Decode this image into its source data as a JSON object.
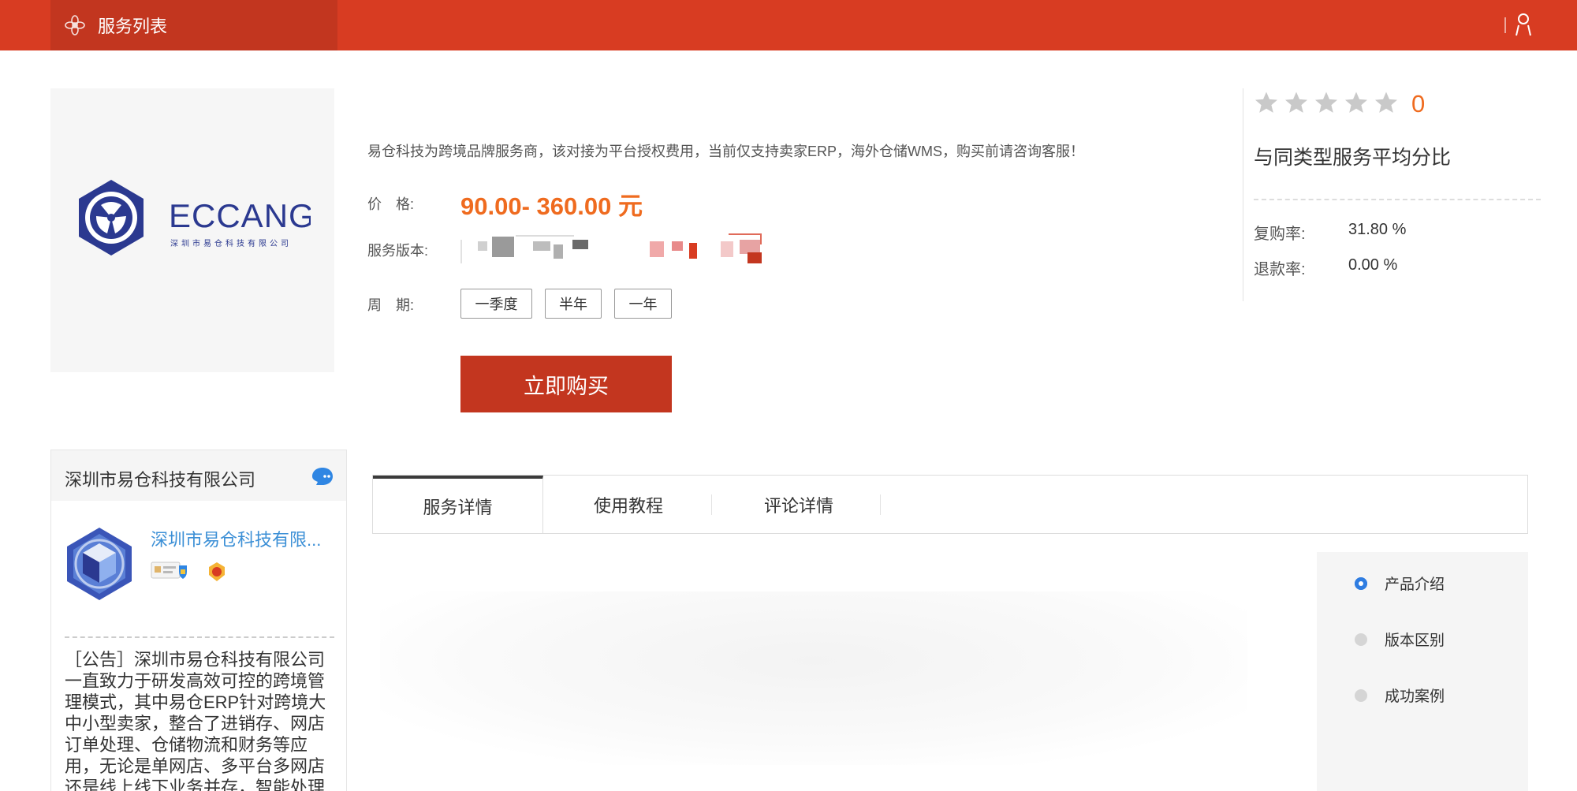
{
  "header": {
    "tab_label": "服务列表",
    "tab_icon": "settings-flower-icon",
    "user_icon": "user-icon",
    "colors": {
      "bar": "#d83c22",
      "tab": "#c2361f"
    }
  },
  "product": {
    "logo": {
      "brand": "ECCANG",
      "subtitle": "深圳市易仓科技有限公司"
    },
    "description": "易仓科技为跨境品牌服务商，该对接为平台授权费用，当前仅支持卖家ERP，海外仓储WMS，购买前请咨询客服！",
    "price_label": "价　格:",
    "price": "90.00- 360.00 元",
    "version_label": "服务版本:",
    "period_label": "周　期:",
    "periods": [
      "一季度",
      "半年",
      "一年"
    ],
    "buy_label": "立即购买"
  },
  "rating": {
    "stars_filled": 0,
    "stars_total": 5,
    "score": "0",
    "caption": "与同类型服务平均分比",
    "stats": [
      {
        "label": "复购率:",
        "value": "31.80 %"
      },
      {
        "label": "退款率:",
        "value": "0.00 %"
      }
    ]
  },
  "company": {
    "header_name": "深圳市易仓科技有限公司",
    "link_name": "深圳市易仓科技有限...",
    "notice": "［公告］深圳市易仓科技有限公司一直致力于研发高效可控的跨境管理模式，其中易仓ERP针对跨境大中小型卖家，整合了进销存、网店订单处理、仓储物流和财务等应用，无论是单网店、多平台多网店还是线上线下业务并存，智能处理"
  },
  "tabs": [
    {
      "label": "服务详情",
      "active": true
    },
    {
      "label": "使用教程",
      "active": false
    },
    {
      "label": "评论详情",
      "active": false
    }
  ],
  "side_nav": [
    {
      "label": "产品介绍",
      "active": true
    },
    {
      "label": "版本区别",
      "active": false
    },
    {
      "label": "成功案例",
      "active": false
    }
  ]
}
